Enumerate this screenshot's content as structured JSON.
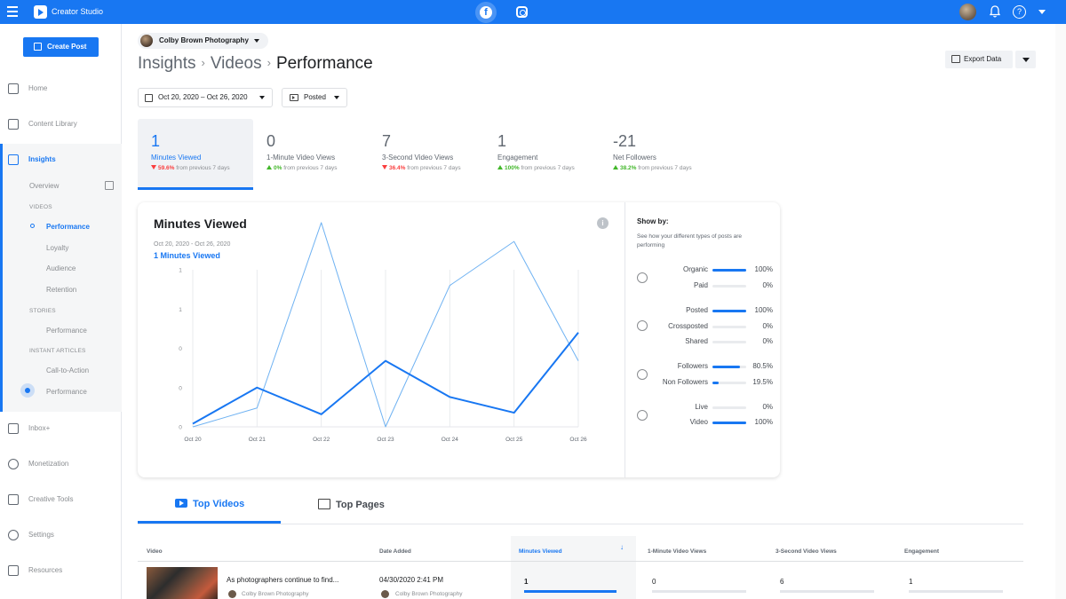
{
  "app": {
    "title": "Creator Studio"
  },
  "topbar": {
    "platform_fb": "f",
    "help": "?"
  },
  "sidebar": {
    "create_label": "Create Post",
    "nav": [
      {
        "label": "Home",
        "icon": "home-icon"
      },
      {
        "label": "Content Library",
        "icon": "library-icon"
      },
      {
        "label": "Insights",
        "icon": "insights-icon"
      },
      {
        "label": "Inbox+",
        "icon": "inbox-icon"
      },
      {
        "label": "Monetization",
        "icon": "dollar-icon"
      },
      {
        "label": "Creative Tools",
        "icon": "tools-icon"
      },
      {
        "label": "Settings",
        "icon": "gear-icon"
      },
      {
        "label": "Resources",
        "icon": "resources-icon"
      }
    ],
    "insights_sub": {
      "overview": "Overview",
      "videos_section": "VIDEOS",
      "videos": [
        "Performance",
        "Loyalty",
        "Audience",
        "Retention"
      ],
      "stories_section": "STORIES",
      "stories": [
        "Performance"
      ],
      "instant_section": "INSTANT ARTICLES",
      "instant": [
        "Call-to-Action",
        "Performance"
      ]
    }
  },
  "header": {
    "page_name": "Colby Brown Photography",
    "breadcrumb": [
      "Insights",
      "Videos",
      "Performance"
    ],
    "export_label": "Export Data",
    "date_range": "Oct 20, 2020 – Oct 26, 2020",
    "filter_label": "Posted"
  },
  "metrics": [
    {
      "value": "1",
      "label": "Minutes Viewed",
      "change": "59.6%",
      "dir": "down",
      "suffix": "from previous 7 days"
    },
    {
      "value": "0",
      "label": "1-Minute Video Views",
      "change": "0%",
      "dir": "up",
      "suffix": "from previous 7 days"
    },
    {
      "value": "7",
      "label": "3-Second Video Views",
      "change": "36.4%",
      "dir": "down",
      "suffix": "from previous 7 days"
    },
    {
      "value": "1",
      "label": "Engagement",
      "change": "100%",
      "dir": "up",
      "suffix": "from previous 7 days"
    },
    {
      "value": "-21",
      "label": "Net Followers",
      "change": "38.2%",
      "dir": "up",
      "suffix": "from previous 7 days"
    }
  ],
  "chart_card": {
    "title": "Minutes Viewed",
    "info": "i",
    "range": "Oct 20, 2020 - Oct 26, 2020",
    "summary": "1  Minutes Viewed"
  },
  "chart_data": {
    "type": "line",
    "categories": [
      "Oct 20",
      "Oct 21",
      "Oct 22",
      "Oct 23",
      "Oct 24",
      "Oct 25",
      "Oct 26"
    ],
    "y_tick_labels": [
      "1",
      "1",
      "0",
      "0",
      "0"
    ],
    "ylim": [
      0,
      1
    ],
    "series": [
      {
        "values": [
          0.02,
          0.25,
          0.08,
          0.42,
          0.19,
          0.09,
          0.6
        ],
        "color": "#1877f2"
      },
      {
        "values": [
          0.0,
          0.12,
          1.3,
          0.0,
          0.9,
          1.18,
          0.42
        ],
        "color": "#6fb2f2"
      }
    ]
  },
  "show_by": {
    "title": "Show by:",
    "desc": "See how your different types of posts are performing",
    "groups": [
      [
        {
          "name": "Organic",
          "pct": "100%",
          "value": 1.0
        },
        {
          "name": "Paid",
          "pct": "0%",
          "value": 0.0
        }
      ],
      [
        {
          "name": "Posted",
          "pct": "100%",
          "value": 1.0
        },
        {
          "name": "Crossposted",
          "pct": "0%",
          "value": 0.0
        },
        {
          "name": "Shared",
          "pct": "0%",
          "value": 0.0
        }
      ],
      [
        {
          "name": "Followers",
          "pct": "80.5%",
          "value": 0.805
        },
        {
          "name": "Non Followers",
          "pct": "19.5%",
          "value": 0.195
        }
      ],
      [
        {
          "name": "Live",
          "pct": "0%",
          "value": 0.0
        },
        {
          "name": "Video",
          "pct": "100%",
          "value": 1.0
        }
      ]
    ]
  },
  "tabs": {
    "top_videos": "Top Videos",
    "top_pages": "Top Pages"
  },
  "table": {
    "headers": [
      "Video",
      "Date Added",
      "Minutes Viewed",
      "1-Minute Video Views",
      "3-Second Video Views",
      "Engagement"
    ],
    "sort_arrow": "↓",
    "rows": [
      {
        "title": "As photographers continue to find...",
        "author": "Colby Brown Photography",
        "date": "04/30/2020 2:41 PM",
        "date_author": "Colby Brown Photography",
        "minutes": "1",
        "minutes_fill": 1.0,
        "one_min": "0",
        "one_min_fill": 0.0,
        "three_sec": "6",
        "three_sec_fill": 0.0,
        "engagement": "1",
        "engagement_fill": 0.0
      }
    ]
  }
}
